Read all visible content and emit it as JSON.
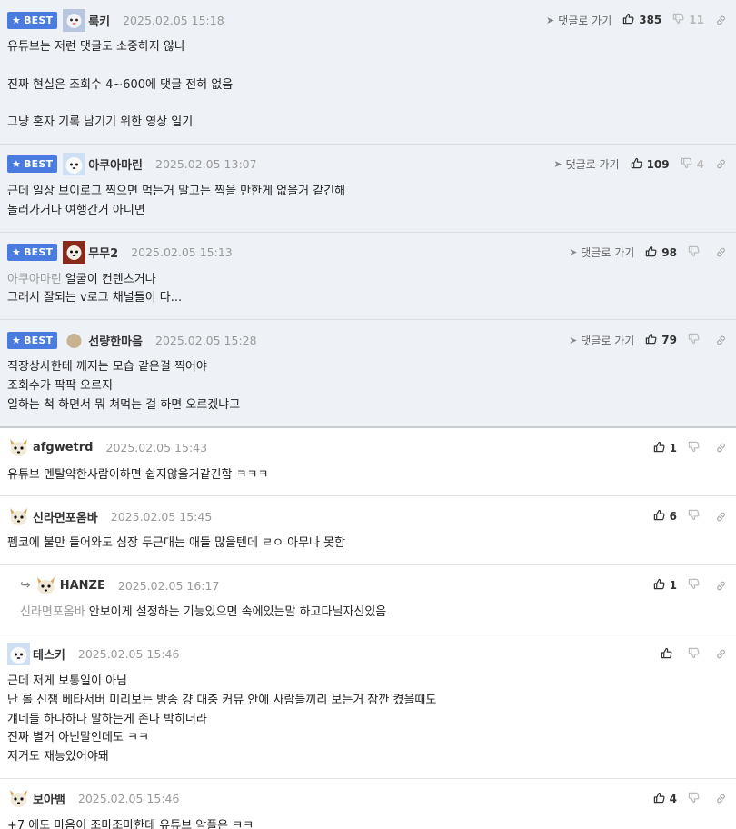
{
  "colors": {
    "best_badge_bg": "#4a7be0",
    "best_row_bg": "#eef1f6",
    "muted": "#999999"
  },
  "icons": {
    "best": "star-icon",
    "reply_link": "send-arrow-icon",
    "like": "thumbs-up-icon",
    "dislike": "thumbs-down-icon",
    "permalink": "link-icon",
    "reply_indicator": "reply-arrow-icon"
  },
  "best_label": "BEST",
  "reply_link_label": "댓글로 가기",
  "comments": [
    {
      "best": true,
      "author": "룩키",
      "date": "2025.02.05 15:18",
      "likes": "385",
      "dislikes": "11",
      "lines": [
        "유튜브는 저런 댓글도 소중하지 않나",
        "",
        "진짜 현실은 조회수 4~600에 댓글 전혀 없음",
        "",
        "그냥 혼자 기록 남기기 위한 영상 일기"
      ]
    },
    {
      "best": true,
      "author": "아쿠아마린",
      "date": "2025.02.05 13:07",
      "likes": "109",
      "dislikes": "4",
      "lines": [
        "근데 일상 브이로그 찍으면 먹는거 말고는 찍을 만한게 없을거 같긴해",
        "놀러가거나 여행간거 아니면"
      ]
    },
    {
      "best": true,
      "author": "무무2",
      "date": "2025.02.05 15:13",
      "likes": "98",
      "dislikes": "",
      "mention": "아쿠아마린",
      "lines": [
        "얼굴이 컨텐츠거나",
        "그래서 잘되는 v로그 채널들이 다..."
      ]
    },
    {
      "best": true,
      "author": "선량한마음",
      "date": "2025.02.05 15:28",
      "likes": "79",
      "dislikes": "",
      "lines": [
        "직장상사한테 깨지는 모습 같은걸 찍어야",
        "조회수가 팍팍 오르지",
        "일하는 척 하면서 뭐 쳐먹는 걸 하면 오르겠냐고"
      ]
    },
    {
      "author": "afgwetrd",
      "date": "2025.02.05 15:43",
      "likes": "1",
      "lines": [
        "유튜브 멘탈약한사람이하면 쉽지않을거같긴함 ㅋㅋㅋ"
      ]
    },
    {
      "author": "신라면포옴바",
      "date": "2025.02.05 15:45",
      "likes": "6",
      "lines": [
        "펨코에 불만 들어와도 심장 두근대는 애들 많을텐데 ㄹㅇ 아무나 못함"
      ]
    },
    {
      "reply": true,
      "author": "HANZE",
      "date": "2025.02.05 16:17",
      "likes": "1",
      "mention": "신라면포옴바",
      "lines": [
        "안보이게 설정하는 기능있으면 속에있는말 하고다닐자신있음"
      ]
    },
    {
      "author": "테스키",
      "date": "2025.02.05 15:46",
      "likes": "",
      "lines": [
        "근데 저게 보통일이 아님",
        "난 롤 신챔 베타서버 미리보는 방송 걍 대충 커뮤 안에 사람들끼리 보는거 잠깐 켰을때도",
        "걔네들 하나하나 말하는게 존나 박히더라",
        "진짜 별거 아닌말인데도 ㅋㅋ",
        "저거도 재능있어야돼"
      ]
    },
    {
      "author": "보아뱀",
      "date": "2025.02.05 15:46",
      "likes": "4",
      "lines": [
        "+7 에도 마음이 조마조마한데 유튜브 악플은 ㅋㅋ"
      ]
    }
  ]
}
